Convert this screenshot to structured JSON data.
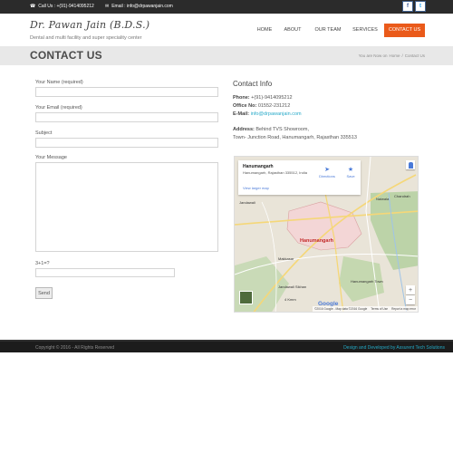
{
  "topbar": {
    "call_glyph": "☎",
    "call_text": "Call Us : +(91)-9414095212",
    "email_glyph": "✉",
    "email_text": "Email : info@drpawanjain.com",
    "social": [
      {
        "icon": "facebook-icon",
        "glyph": "f"
      },
      {
        "icon": "twitter-icon",
        "glyph": "t"
      }
    ]
  },
  "header": {
    "logo": "Dr. Pawan Jain (B.D.S.)",
    "tagline": "Dental and multi facility and super speciality center"
  },
  "nav": {
    "items": [
      {
        "label": "HOME"
      },
      {
        "label": "ABOUT"
      },
      {
        "label": "OUR TEAM"
      },
      {
        "label": "SERVICES"
      },
      {
        "label": "CONTACT US",
        "active": true
      }
    ],
    "active_color": "#ea5a1a"
  },
  "page_title": "CONTACT US",
  "breadcrumb": {
    "prefix": "You are Now on",
    "home": "Home",
    "separator": "/",
    "current": "Contact Us"
  },
  "form": {
    "name_label": "Your Name (required)",
    "name_value": "",
    "email_label": "Your Email (required)",
    "email_value": "",
    "subject_label": "Subject",
    "subject_value": "",
    "message_label": "Your Message",
    "message_value": "",
    "captcha_label": "3+1=?",
    "captcha_value": "",
    "send_label": "Send"
  },
  "contact_info": {
    "title": "Contact Info",
    "phone_label": "Phone:",
    "phone_value": "+(91)-9414095212",
    "office_label": "Office No:",
    "office_value": "01552-231212",
    "email_label": "E-Mail:",
    "email_value": "info@drpawanjain.com",
    "address_label": "Address:",
    "address_line1": "Behind TVS Showroom,",
    "address_line2": "Town- Junction Road, Hanumangarh, Rajasthan 335513"
  },
  "map": {
    "card_place": "Hanumangarh",
    "card_address": "Hanumangarh, Rajasthan 335512, India",
    "card_larger_map": "View larger map",
    "directions_icon": "directions-icon",
    "directions_label": "Directions",
    "save_icon": "star-icon",
    "save_label": "Save",
    "town_label": "Hanumangarh",
    "labels": {
      "jandawali": "Jandawali",
      "naiwala": "Naiwala",
      "chandrah": "Chandrah",
      "makkasar": "Makkasar",
      "hanumangarh_town": "Hanumangarh Town",
      "four_kmm": "4 Kmm",
      "jandawali_sikhan": "Jandawali Sikhan"
    },
    "zoom_in": "+",
    "zoom_out": "−",
    "google_logo": "Google",
    "attribution": "©2016 Google - Map data ©2016 Google",
    "terms": "Terms of Use",
    "report": "Report a map error",
    "colors": {
      "land": "#e9e4d8",
      "green": "#bcd3a8",
      "town": "#f3d6d6",
      "road": "#f5d778"
    }
  },
  "footer": {
    "copyright": "Copyright © 2016 - All Rights Reserved",
    "credit": "Design and Developed by Assurent Tech Solutions"
  }
}
